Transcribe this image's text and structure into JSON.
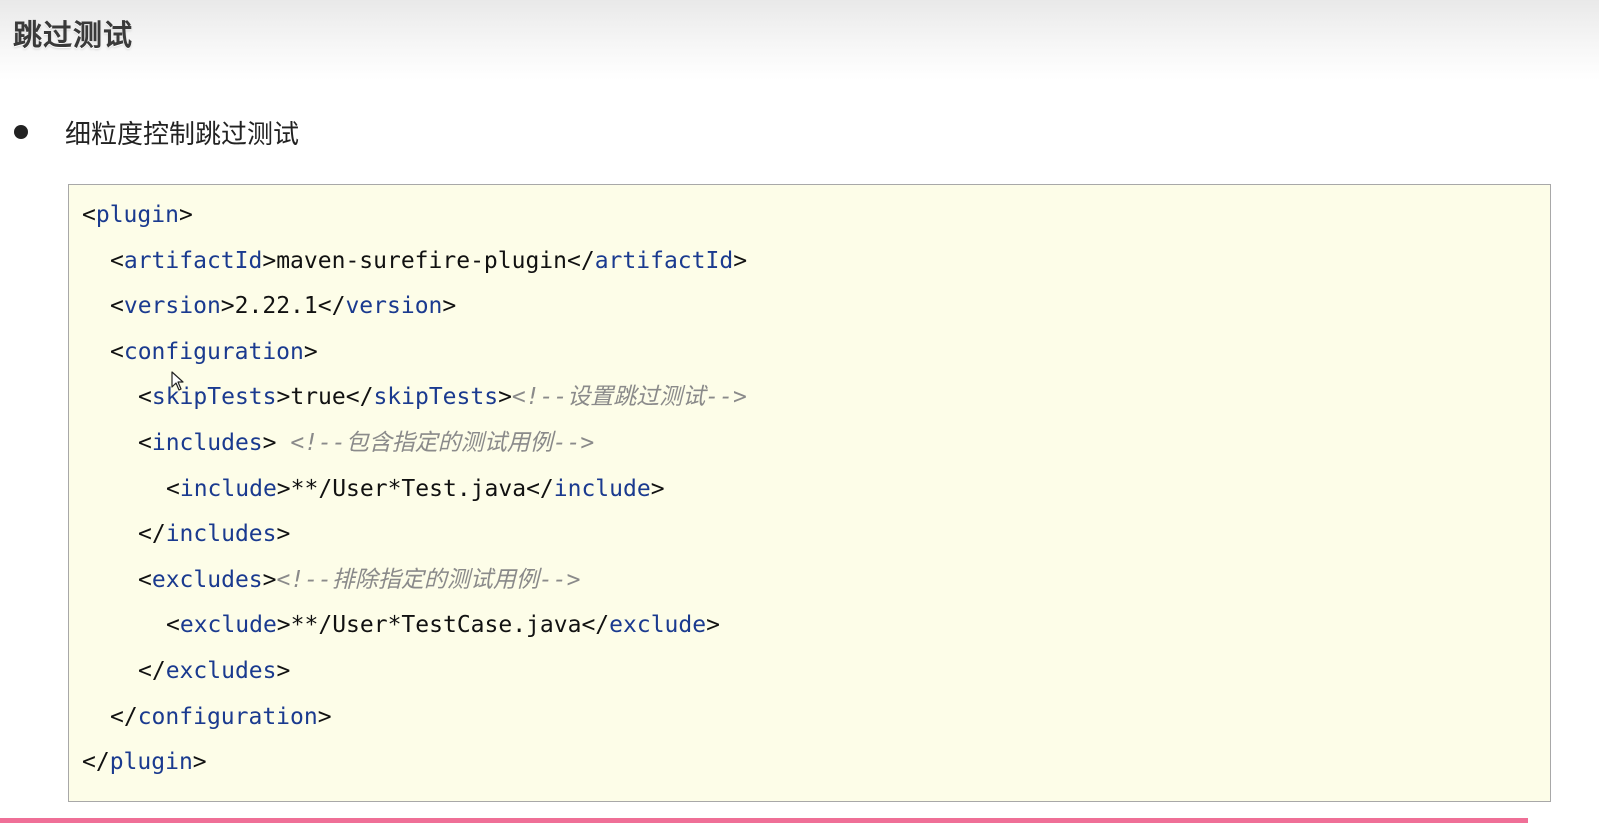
{
  "header": {
    "title": "跳过测试"
  },
  "bullet": {
    "text": "细粒度控制跳过测试"
  },
  "code": {
    "lines": [
      {
        "indent": 0,
        "parts": [
          [
            "p",
            "<"
          ],
          [
            "t",
            "plugin"
          ],
          [
            "p",
            ">"
          ]
        ]
      },
      {
        "indent": 1,
        "parts": [
          [
            "p",
            "<"
          ],
          [
            "t",
            "artifactId"
          ],
          [
            "p",
            ">"
          ],
          [
            "x",
            "maven-surefire-plugin"
          ],
          [
            "p",
            "</"
          ],
          [
            "t",
            "artifactId"
          ],
          [
            "p",
            ">"
          ]
        ]
      },
      {
        "indent": 1,
        "parts": [
          [
            "p",
            "<"
          ],
          [
            "t",
            "version"
          ],
          [
            "p",
            ">"
          ],
          [
            "x",
            "2.22.1"
          ],
          [
            "p",
            "</"
          ],
          [
            "t",
            "version"
          ],
          [
            "p",
            ">"
          ]
        ]
      },
      {
        "indent": 1,
        "parts": [
          [
            "p",
            "<"
          ],
          [
            "t",
            "configuration"
          ],
          [
            "p",
            ">"
          ]
        ]
      },
      {
        "indent": 2,
        "parts": [
          [
            "p",
            "<"
          ],
          [
            "t",
            "skipTests"
          ],
          [
            "p",
            ">"
          ],
          [
            "x",
            "true"
          ],
          [
            "p",
            "</"
          ],
          [
            "t",
            "skipTests"
          ],
          [
            "p",
            ">"
          ],
          [
            "c",
            "<!--设置跳过测试-->"
          ]
        ]
      },
      {
        "indent": 2,
        "parts": [
          [
            "p",
            "<"
          ],
          [
            "t",
            "includes"
          ],
          [
            "p",
            "> "
          ],
          [
            "c",
            "<!--包含指定的测试用例-->"
          ]
        ]
      },
      {
        "indent": 3,
        "parts": [
          [
            "p",
            "<"
          ],
          [
            "t",
            "include"
          ],
          [
            "p",
            ">"
          ],
          [
            "x",
            "**/User*Test.java"
          ],
          [
            "p",
            "</"
          ],
          [
            "t",
            "include"
          ],
          [
            "p",
            ">"
          ]
        ]
      },
      {
        "indent": 2,
        "parts": [
          [
            "p",
            "</"
          ],
          [
            "t",
            "includes"
          ],
          [
            "p",
            ">"
          ]
        ]
      },
      {
        "indent": 2,
        "parts": [
          [
            "p",
            "<"
          ],
          [
            "t",
            "excludes"
          ],
          [
            "p",
            ">"
          ],
          [
            "c",
            "<!--排除指定的测试用例-->"
          ]
        ]
      },
      {
        "indent": 3,
        "parts": [
          [
            "p",
            "<"
          ],
          [
            "t",
            "exclude"
          ],
          [
            "p",
            ">"
          ],
          [
            "x",
            "**/User*TestCase.java"
          ],
          [
            "p",
            "</"
          ],
          [
            "t",
            "exclude"
          ],
          [
            "p",
            ">"
          ]
        ]
      },
      {
        "indent": 2,
        "parts": [
          [
            "p",
            "</"
          ],
          [
            "t",
            "excludes"
          ],
          [
            "p",
            ">"
          ]
        ]
      },
      {
        "indent": 1,
        "parts": [
          [
            "p",
            "</"
          ],
          [
            "t",
            "configuration"
          ],
          [
            "p",
            ">"
          ]
        ]
      },
      {
        "indent": 0,
        "parts": [
          [
            "p",
            "</"
          ],
          [
            "t",
            "plugin"
          ],
          [
            "p",
            ">"
          ]
        ]
      }
    ]
  },
  "colors": {
    "tag": "#1a3a8f",
    "comment": "#8a8a8a",
    "code_background": "#fdfde8",
    "accent_bar": "#ef6f97"
  },
  "icons": {
    "cursor": "mouse-pointer-icon"
  }
}
